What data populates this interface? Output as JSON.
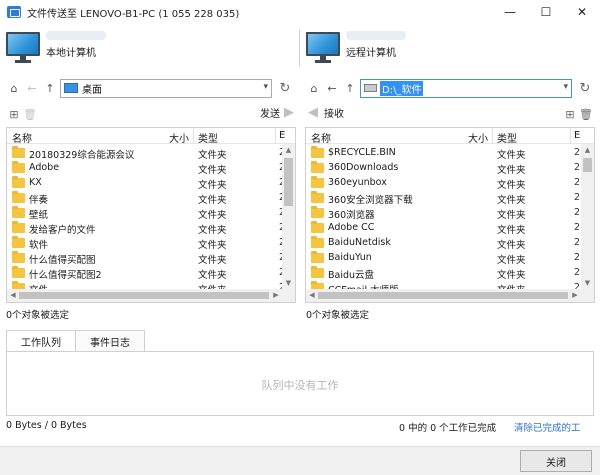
{
  "window": {
    "title": "文件传送至 LENOVO-B1-PC (1 055 228 035)",
    "minimize": "—",
    "maximize": "☐",
    "close": "✕"
  },
  "local": {
    "label": "本地计算机",
    "path": "桌面",
    "send_label": "发送",
    "status": "0个对象被选定",
    "columns": {
      "name": "名称",
      "size": "大小",
      "type": "类型",
      "date": "E"
    },
    "files": [
      {
        "name": "20180329综合能源会议",
        "type": "文件夹",
        "date": "2"
      },
      {
        "name": "Adobe",
        "type": "文件夹",
        "date": "2"
      },
      {
        "name": "KX",
        "type": "文件夹",
        "date": "2"
      },
      {
        "name": "伴奏",
        "type": "文件夹",
        "date": "2"
      },
      {
        "name": "壁纸",
        "type": "文件夹",
        "date": "2"
      },
      {
        "name": "发给客户的文件",
        "type": "文件夹",
        "date": "2"
      },
      {
        "name": "软件",
        "type": "文件夹",
        "date": "2"
      },
      {
        "name": "什么值得买配图",
        "type": "文件夹",
        "date": "2"
      },
      {
        "name": "什么值得买配图2",
        "type": "文件夹",
        "date": "2"
      },
      {
        "name": "文件",
        "type": "文件夹",
        "date": "2"
      }
    ]
  },
  "remote": {
    "label": "远程计算机",
    "path": "D:\\_软件",
    "receive_label": "接收",
    "status": "0个对象被选定",
    "columns": {
      "name": "名称",
      "size": "大小",
      "type": "类型",
      "date": "E"
    },
    "files": [
      {
        "name": "$RECYCLE.BIN",
        "type": "文件夹",
        "date": "2"
      },
      {
        "name": "360Downloads",
        "type": "文件夹",
        "date": "2"
      },
      {
        "name": "360eyunbox",
        "type": "文件夹",
        "date": "2"
      },
      {
        "name": "360安全浏览器下载",
        "type": "文件夹",
        "date": "2"
      },
      {
        "name": "360浏览器",
        "type": "文件夹",
        "date": "2"
      },
      {
        "name": "Adobe CC",
        "type": "文件夹",
        "date": "2"
      },
      {
        "name": "BaiduNetdisk",
        "type": "文件夹",
        "date": "2"
      },
      {
        "name": "BaiduYun",
        "type": "文件夹",
        "date": "2"
      },
      {
        "name": "Baidu云盘",
        "type": "文件夹",
        "date": "2"
      },
      {
        "name": "CCFmail 大师版",
        "type": "文件夹",
        "date": "2"
      }
    ]
  },
  "tabs": [
    {
      "label": "工作队列",
      "active": true
    },
    {
      "label": "事件日志",
      "active": false
    }
  ],
  "queue": {
    "empty_text": "队列中没有工作"
  },
  "footer": {
    "transfer": "0 Bytes / 0 Bytes",
    "progress": "0 中的 0 个工作已完成",
    "clear_link": "清除已完成的工",
    "close_label": "关闭"
  },
  "colors": {
    "accent": "#2d7be0",
    "link": "#2a6fd6",
    "folder": "#f5c542",
    "selection": "#3390ff"
  }
}
